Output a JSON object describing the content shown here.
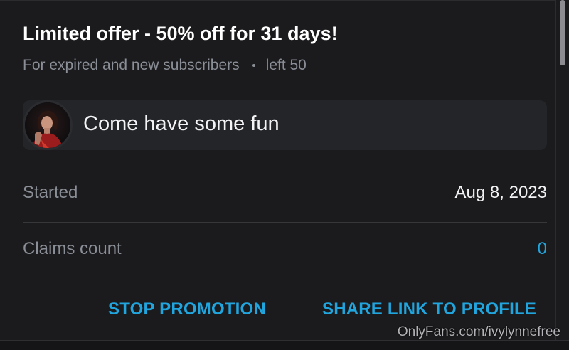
{
  "promotion": {
    "title": "Limited offer - 50% off for 31 days!",
    "audience": "For expired and new subscribers",
    "remaining": "left 50",
    "message": "Come have some fun",
    "started_label": "Started",
    "started_value": "Aug 8, 2023",
    "claims_label": "Claims count",
    "claims_value": "0"
  },
  "actions": {
    "stop_label": "STOP PROMOTION",
    "share_label": "SHARE LINK TO PROFILE"
  },
  "watermark": "OnlyFans.com/ivylynnefree",
  "colors": {
    "background": "#1b1b1d",
    "accent": "#21a5de",
    "muted_text": "#8a8e96",
    "message_bg": "#242528"
  }
}
